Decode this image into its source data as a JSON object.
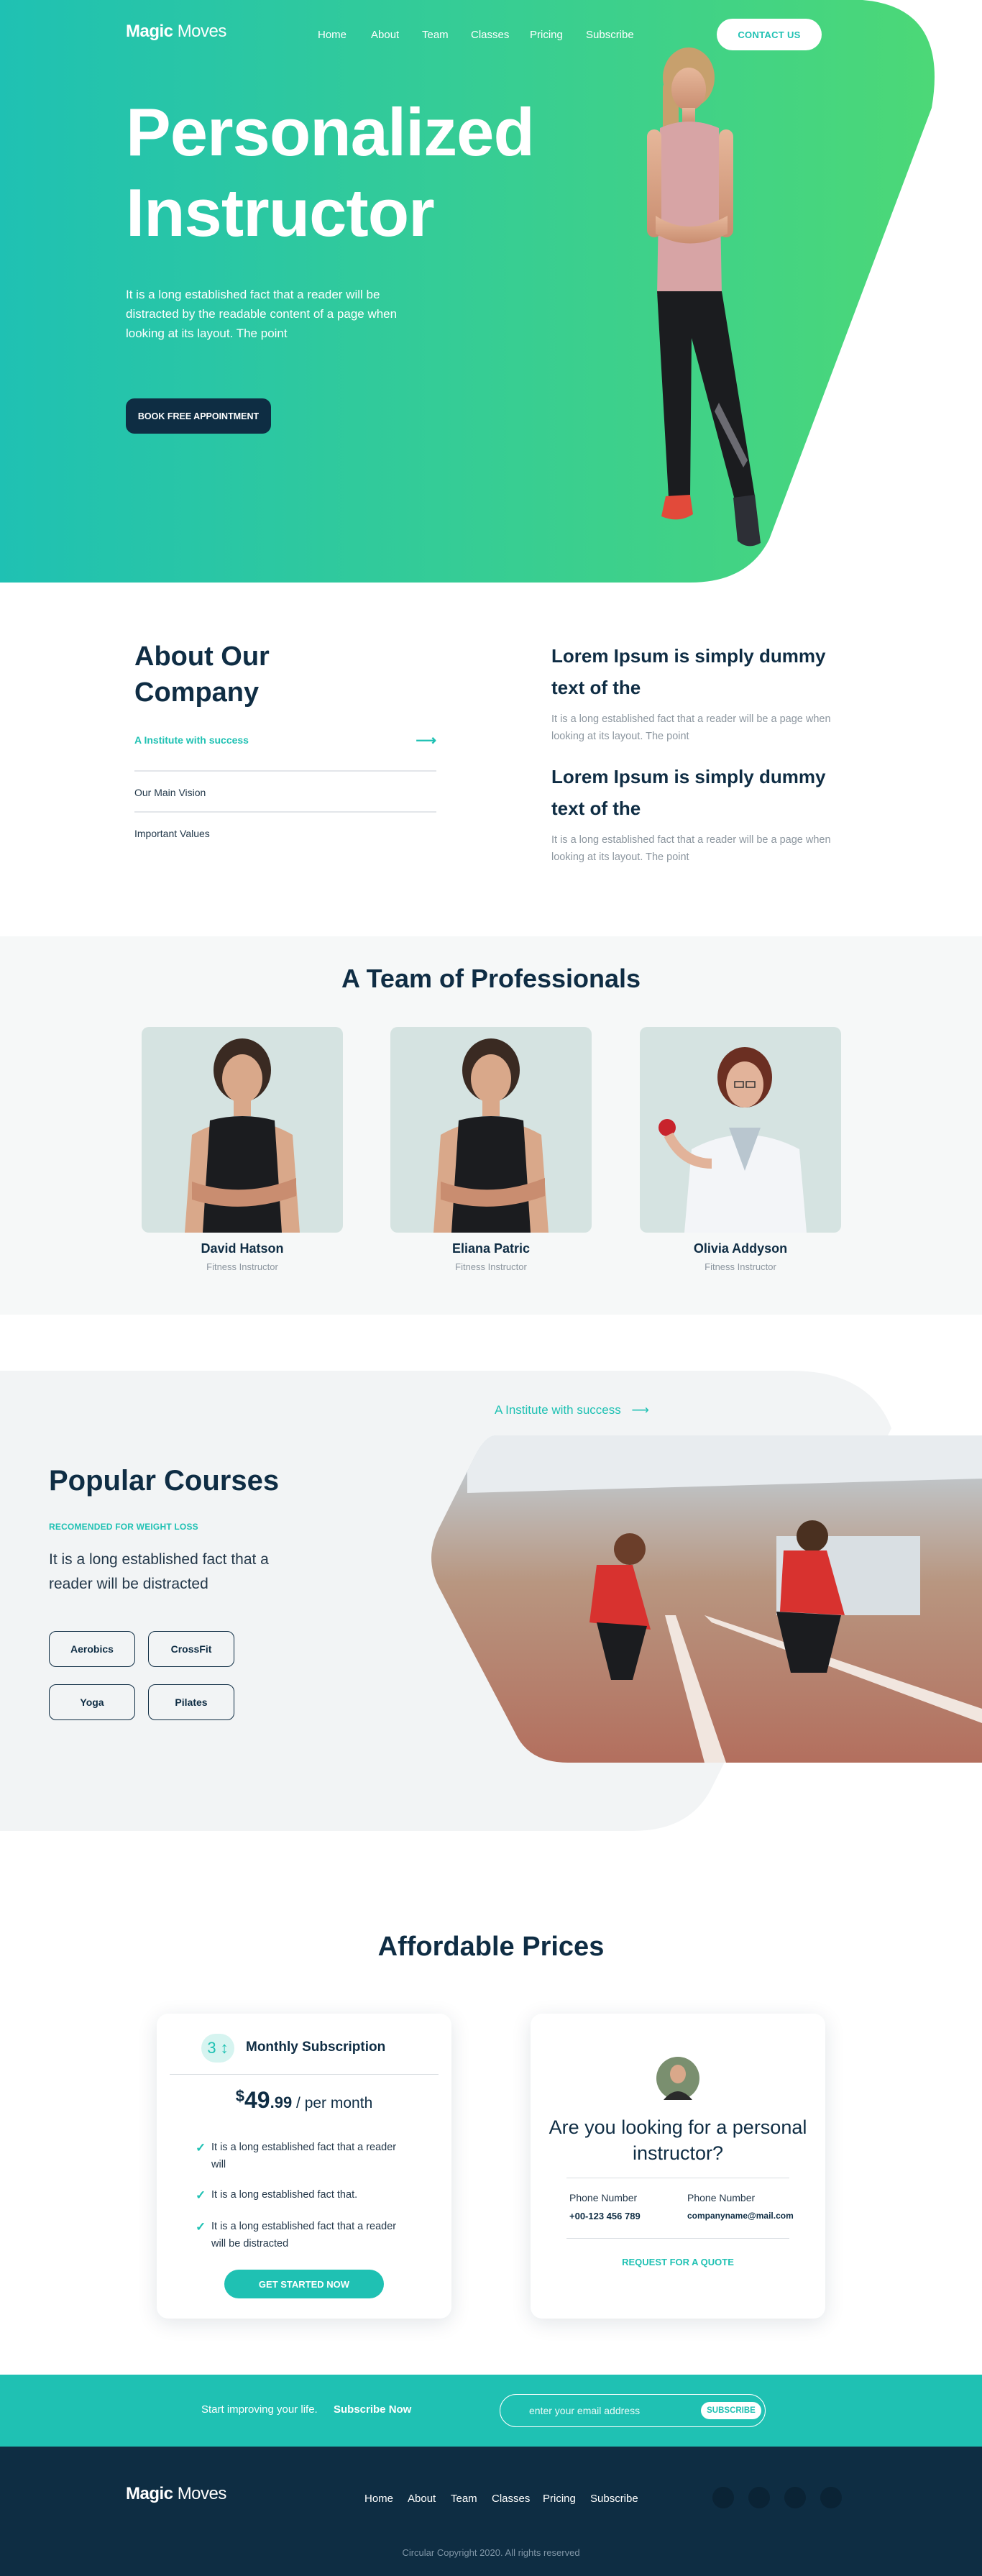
{
  "colors": {
    "accent": "#1fc1b3",
    "green": "#4cd877",
    "navy": "#0e2d43",
    "light_bg": "#f6f8f8"
  },
  "header": {
    "brand_bold": "Magic",
    "brand_light": "Moves",
    "nav": [
      "Home",
      "About",
      "Team",
      "Classes",
      "Pricing",
      "Subscribe"
    ],
    "contact_label": "CONTACT US"
  },
  "hero": {
    "title_line1": "Personalized",
    "title_line2": "Instructor",
    "text": "It is a long established fact that a reader will be distracted by the readable content of a page when looking at its layout. The point",
    "cta_label": "BOOK FREE APPOINTMENT"
  },
  "about": {
    "title": "About Our Company",
    "items": [
      {
        "label": "A Institute with success",
        "active": true,
        "icon": "arrow-right-icon"
      },
      {
        "label": "Our Main Vision",
        "active": false
      },
      {
        "label": "Important Values",
        "active": false
      }
    ],
    "blocks": [
      {
        "heading": "Lorem Ipsum is simply dummy text of the",
        "text": "It is a long established fact that a reader will be a page when looking at its layout. The point"
      },
      {
        "heading": "Lorem Ipsum is simply dummy text of the",
        "text": "It is a long established fact that a reader will be a page when looking at its layout. The point"
      }
    ]
  },
  "team": {
    "title": "A Team of Professionals",
    "members": [
      {
        "name": "David Hatson",
        "role": "Fitness Instructor"
      },
      {
        "name": "Eliana Patric",
        "role": "Fitness Instructor"
      },
      {
        "name": "Olivia Addyson",
        "role": "Fitness Instructor"
      }
    ]
  },
  "courses": {
    "link": "A Institute with success",
    "title": "Popular Courses",
    "subtitle": "RECOMENDED FOR WEIGHT LOSS",
    "text": "It is a long established fact that a reader will be distracted",
    "buttons": [
      "Aerobics",
      "CrossFit",
      "Yoga",
      "Pilates"
    ]
  },
  "prices": {
    "title": "Affordable Prices",
    "subscription": {
      "badge": "3 ↕",
      "name": "Monthly Subscription",
      "currency": "$",
      "amount": "49",
      "cents": ".99",
      "period": " / per month",
      "features": [
        "It is a long established fact that a reader will",
        "It is a long established fact that.",
        "It is a long established fact that a reader will be distracted"
      ],
      "cta": "GET STARTED NOW"
    },
    "quote": {
      "heading": "Are you looking for a personal instructor?",
      "phone_label_1": "Phone Number",
      "phone_value_1": "+00-123 456 789",
      "phone_label_2": "Phone Number",
      "phone_value_2": "companyname@mail.com",
      "cta": "REQUEST FOR A QUOTE"
    }
  },
  "subscribe": {
    "text": "Start improving your life.",
    "bold": "Subscribe Now",
    "placeholder": "enter your email address",
    "button": "SUBSCRIBE"
  },
  "footer": {
    "brand_bold": "Magic",
    "brand_light": "Moves",
    "nav": [
      "Home",
      "About",
      "Team",
      "Classes",
      "Pricing",
      "Subscribe"
    ],
    "copyright": "Circular Copyright 2020. All rights reserved"
  }
}
